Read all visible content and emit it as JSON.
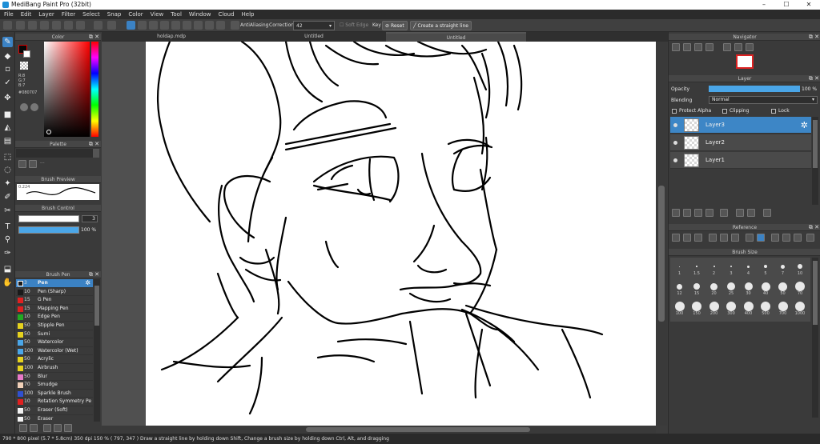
{
  "app": {
    "title": "MediBang Paint Pro (32bit)",
    "win_controls": [
      "–",
      "☐",
      "✕"
    ]
  },
  "menu": [
    "File",
    "Edit",
    "Layer",
    "Filter",
    "Select",
    "Snap",
    "Color",
    "View",
    "Tool",
    "Window",
    "Cloud",
    "Help"
  ],
  "toolbar": {
    "antialiasing": "AntiAliasing",
    "correction_label": "Correction",
    "correction_value": "42",
    "soft_edge": "Soft Edge",
    "key_label": "Key",
    "reset": "Reset",
    "straight": "Create a straight line"
  },
  "tabs": [
    "holdap.mdp",
    "Untitled",
    "Untitled"
  ],
  "color_panel": {
    "title": "Color",
    "r": "R:8",
    "g": "G:7",
    "b": "B:7",
    "hex": "#080707",
    "fg_color": "#080707",
    "bg_color": "#ffffff"
  },
  "palette": {
    "title": "Palette"
  },
  "brush_preview": {
    "title": "Brush Preview",
    "size": "0.224"
  },
  "brush_control": {
    "title": "Brush Control",
    "size": "3",
    "opacity": "100 %"
  },
  "brush_list": {
    "title": "Brush Pen",
    "items": [
      {
        "size": "3",
        "name": "Pen",
        "color": "#1a1a1a"
      },
      {
        "size": "10",
        "name": "Pen (Sharp)",
        "color": "#1a1a1a"
      },
      {
        "size": "15",
        "name": "G Pen",
        "color": "#e02020"
      },
      {
        "size": "15",
        "name": "Mapping Pen",
        "color": "#e02020"
      },
      {
        "size": "10",
        "name": "Edge Pen",
        "color": "#22aa22"
      },
      {
        "size": "50",
        "name": "Stipple Pen",
        "color": "#e6d21e"
      },
      {
        "size": "50",
        "name": "Sumi",
        "color": "#e6d21e"
      },
      {
        "size": "50",
        "name": "Watercolor",
        "color": "#4aa6e8"
      },
      {
        "size": "100",
        "name": "Watercolor (Wet)",
        "color": "#4aa6e8"
      },
      {
        "size": "50",
        "name": "Acrylic",
        "color": "#e6d21e"
      },
      {
        "size": "100",
        "name": "Airbrush",
        "color": "#e6d21e"
      },
      {
        "size": "50",
        "name": "Blur",
        "color": "#e879c8"
      },
      {
        "size": "70",
        "name": "Smudge",
        "color": "#f0d0b8"
      },
      {
        "size": "100",
        "name": "Sparkle Brush",
        "color": "#3050d0"
      },
      {
        "size": "10",
        "name": "Rotation Symmetry Pe",
        "color": "#e02020"
      },
      {
        "size": "50",
        "name": "Eraser (Soft)",
        "color": "#f2f2f2"
      },
      {
        "size": "50",
        "name": "Eraser",
        "color": "#f2f2f2"
      }
    ]
  },
  "navigator": {
    "title": "Navigator"
  },
  "layer_panel": {
    "title": "Layer",
    "opacity_label": "Opacity",
    "opacity_value": "100 %",
    "blending_label": "Blending",
    "blending_value": "Normal",
    "protect_alpha": "Protect Alpha",
    "clipping": "Clipping",
    "lock": "Lock",
    "layers": [
      "Layer3",
      "Layer2",
      "Layer1"
    ]
  },
  "reference": {
    "title": "Reference"
  },
  "brush_size": {
    "title": "Brush Size",
    "row1": [
      "1",
      "1.5",
      "2",
      "3",
      "4",
      "5",
      "7",
      "10"
    ],
    "row2": [
      "12",
      "15",
      "20",
      "25",
      "30",
      "40",
      "50",
      "70"
    ],
    "row3": [
      "100",
      "150",
      "200",
      "300",
      "400",
      "500",
      "700",
      "1000"
    ]
  },
  "status": "790 * 800 pixel   (5.7 * 5.8cm)  350 dpi  150 %  ( 797, 347 )  Draw a straight line by holding down Shift, Change a brush size by holding down Ctrl, Alt, and dragging"
}
